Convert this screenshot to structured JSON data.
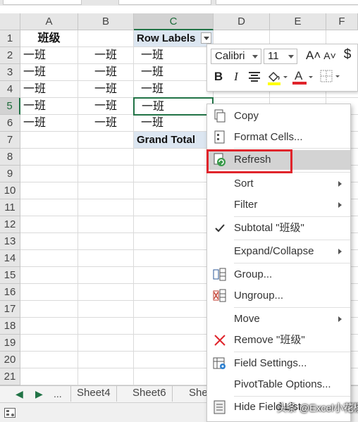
{
  "grid": {
    "columns": [
      "A",
      "B",
      "C",
      "D",
      "E",
      "F"
    ],
    "rows": [
      "1",
      "2",
      "3",
      "4",
      "5",
      "6",
      "7",
      "8",
      "9",
      "10",
      "11",
      "12",
      "13",
      "14",
      "15",
      "16",
      "17",
      "18",
      "19",
      "20",
      "21"
    ],
    "a1": "班级",
    "class_value": "一班",
    "pivot_header": "Row Labels",
    "pivot_items": [
      "一班",
      "一班",
      "一班",
      "一班",
      "一班"
    ],
    "grand_total": "Grand Total"
  },
  "tabs": {
    "ellipsis": "...",
    "sheets": [
      "Sheet4",
      "Sheet6",
      "She"
    ]
  },
  "mini_toolbar": {
    "font_name": "Calibri",
    "font_size": "11",
    "grow_font": "A˄",
    "shrink_font": "A˅",
    "currency": "$",
    "bold": "B",
    "italic": "I"
  },
  "context_menu": {
    "items": [
      {
        "label": "Copy",
        "icon": "copy-icon"
      },
      {
        "label": "Format Cells...",
        "icon": "format-cells-icon"
      },
      {
        "label": "Refresh",
        "icon": "refresh-icon",
        "highlighted": true
      },
      {
        "label": "Sort",
        "submenu": true
      },
      {
        "label": "Filter",
        "submenu": true
      },
      {
        "label": "Subtotal \"班级\"",
        "icon": "checkmark-icon"
      },
      {
        "label": "Expand/Collapse",
        "submenu": true
      },
      {
        "label": "Group...",
        "icon": "group-icon"
      },
      {
        "label": "Ungroup...",
        "icon": "ungroup-icon"
      },
      {
        "label": "Move",
        "submenu": true
      },
      {
        "label": "Remove \"班级\"",
        "icon": "remove-x-icon"
      },
      {
        "label": "Field Settings...",
        "icon": "field-settings-icon"
      },
      {
        "label": "PivotTable Options...",
        "icon": null
      },
      {
        "label": "Hide Field List",
        "icon": "field-list-icon"
      }
    ]
  },
  "watermark": "头条 @Excel小花椒",
  "colors": {
    "excel_green": "#217346",
    "pivot_header_bg": "#dce6f1",
    "highlight_red": "#e0242b",
    "menu_highlight": "#d3d3d3"
  }
}
